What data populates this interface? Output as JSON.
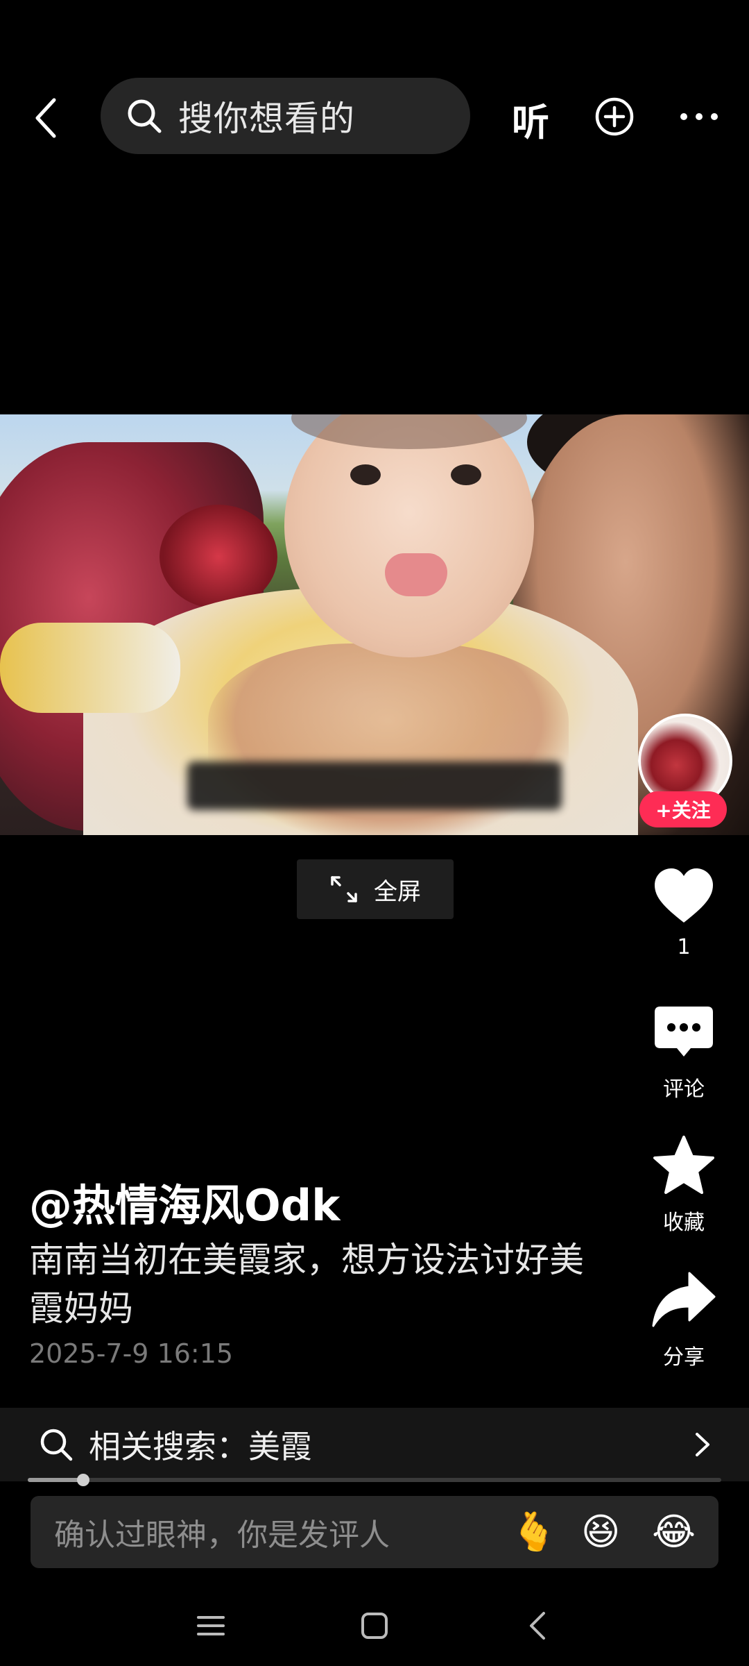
{
  "topbar": {
    "search_placeholder": "搜你想看的",
    "listen_label": "听"
  },
  "video": {
    "follow_label": "+关注",
    "fullscreen_label": "全屏"
  },
  "actions": {
    "like_count": "1",
    "comment_label": "评论",
    "favorite_label": "收藏",
    "share_label": "分享"
  },
  "caption": {
    "author": "@热情海风Odk",
    "description": "南南当初在美霞家，想方设法讨好美霞妈妈",
    "timestamp": "2025-7-9 16:15"
  },
  "related": {
    "text": "相关搜索：美霞"
  },
  "progress": {
    "played_fraction": 0.08
  },
  "comment_bar": {
    "placeholder": "确认过眼神，你是发评人",
    "emojis": [
      "🫰",
      "😆",
      "😂"
    ]
  },
  "colors": {
    "accent_follow": "#fe2c55",
    "background": "#000000"
  },
  "icons": [
    "back-icon",
    "search-icon",
    "add-circle-icon",
    "more-icon",
    "expand-icon",
    "heart-icon",
    "comment-icon",
    "star-icon",
    "share-icon",
    "chevron-right-icon",
    "menu-icon",
    "home-square-icon",
    "system-back-icon"
  ]
}
